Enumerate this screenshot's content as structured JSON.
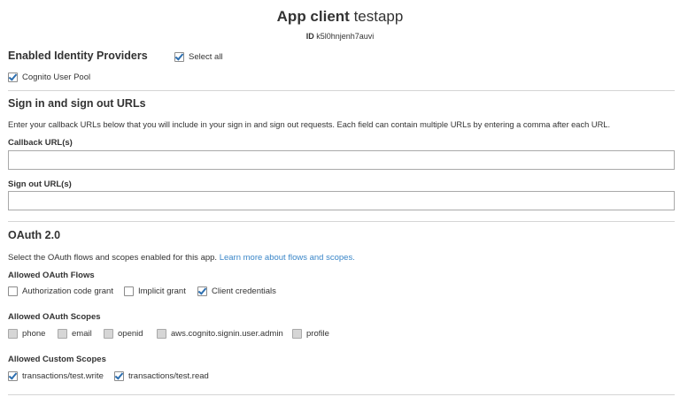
{
  "header": {
    "title_bold": "App client",
    "title_name": "testapp",
    "id_label": "ID",
    "id_value": "k5l0hnjenh7auvi"
  },
  "identity_providers": {
    "heading": "Enabled Identity Providers",
    "select_all_label": "Select all",
    "select_all_checked": true,
    "providers": [
      {
        "label": "Cognito User Pool",
        "checked": true
      }
    ]
  },
  "sign_urls": {
    "heading": "Sign in and sign out URLs",
    "description": "Enter your callback URLs below that you will include in your sign in and sign out requests. Each field can contain multiple URLs by entering a comma after each URL.",
    "callback_label": "Callback URL(s)",
    "callback_value": "",
    "signout_label": "Sign out URL(s)",
    "signout_value": ""
  },
  "oauth": {
    "heading": "OAuth 2.0",
    "description": "Select the OAuth flows and scopes enabled for this app.",
    "learn_more": "Learn more about flows and scopes.",
    "flows_label": "Allowed OAuth Flows",
    "flows": [
      {
        "label": "Authorization code grant",
        "checked": false
      },
      {
        "label": "Implicit grant",
        "checked": false
      },
      {
        "label": "Client credentials",
        "checked": true
      }
    ],
    "scopes_label": "Allowed OAuth Scopes",
    "scopes": [
      {
        "label": "phone",
        "checked": false,
        "disabled": true
      },
      {
        "label": "email",
        "checked": false,
        "disabled": true
      },
      {
        "label": "openid",
        "checked": false,
        "disabled": true
      },
      {
        "label": "aws.cognito.signin.user.admin",
        "checked": false,
        "disabled": true
      },
      {
        "label": "profile",
        "checked": false,
        "disabled": true
      }
    ],
    "custom_label": "Allowed Custom Scopes",
    "custom_scopes": [
      {
        "label": "transactions/test.write",
        "checked": true
      },
      {
        "label": "transactions/test.read",
        "checked": true
      }
    ]
  },
  "colors": {
    "link": "#3a86c8",
    "check": "#2d6fb0"
  }
}
